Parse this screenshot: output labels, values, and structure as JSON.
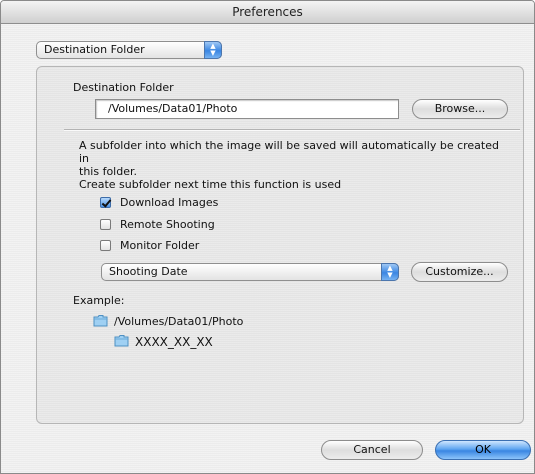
{
  "window": {
    "title": "Preferences"
  },
  "section_popup": {
    "value": "Destination Folder"
  },
  "destination": {
    "heading": "Destination Folder",
    "path": "/Volumes/Data01/Photo",
    "browse_label": "Browse..."
  },
  "subfolder": {
    "description_line1": "A subfolder into which the image will be saved will automatically be created in",
    "description_line2": "this folder.",
    "description_line3": "Create subfolder next time this function is used",
    "options": [
      {
        "label": "Download Images",
        "checked": true
      },
      {
        "label": "Remote Shooting",
        "checked": false
      },
      {
        "label": "Monitor Folder",
        "checked": false
      }
    ],
    "naming_popup_value": "Shooting Date",
    "customize_label": "Customize..."
  },
  "example": {
    "label": "Example:",
    "root_path": "/Volumes/Data01/Photo",
    "subfolder_name": "XXXX_XX_XX"
  },
  "footer": {
    "cancel_label": "Cancel",
    "ok_label": "OK"
  },
  "colors": {
    "accent": "#3a86e2",
    "window_bg": "#ececec",
    "folder": "#8cc6ef"
  },
  "icons": [
    "popup-arrows-icon",
    "checkmark-icon",
    "folder-icon"
  ]
}
